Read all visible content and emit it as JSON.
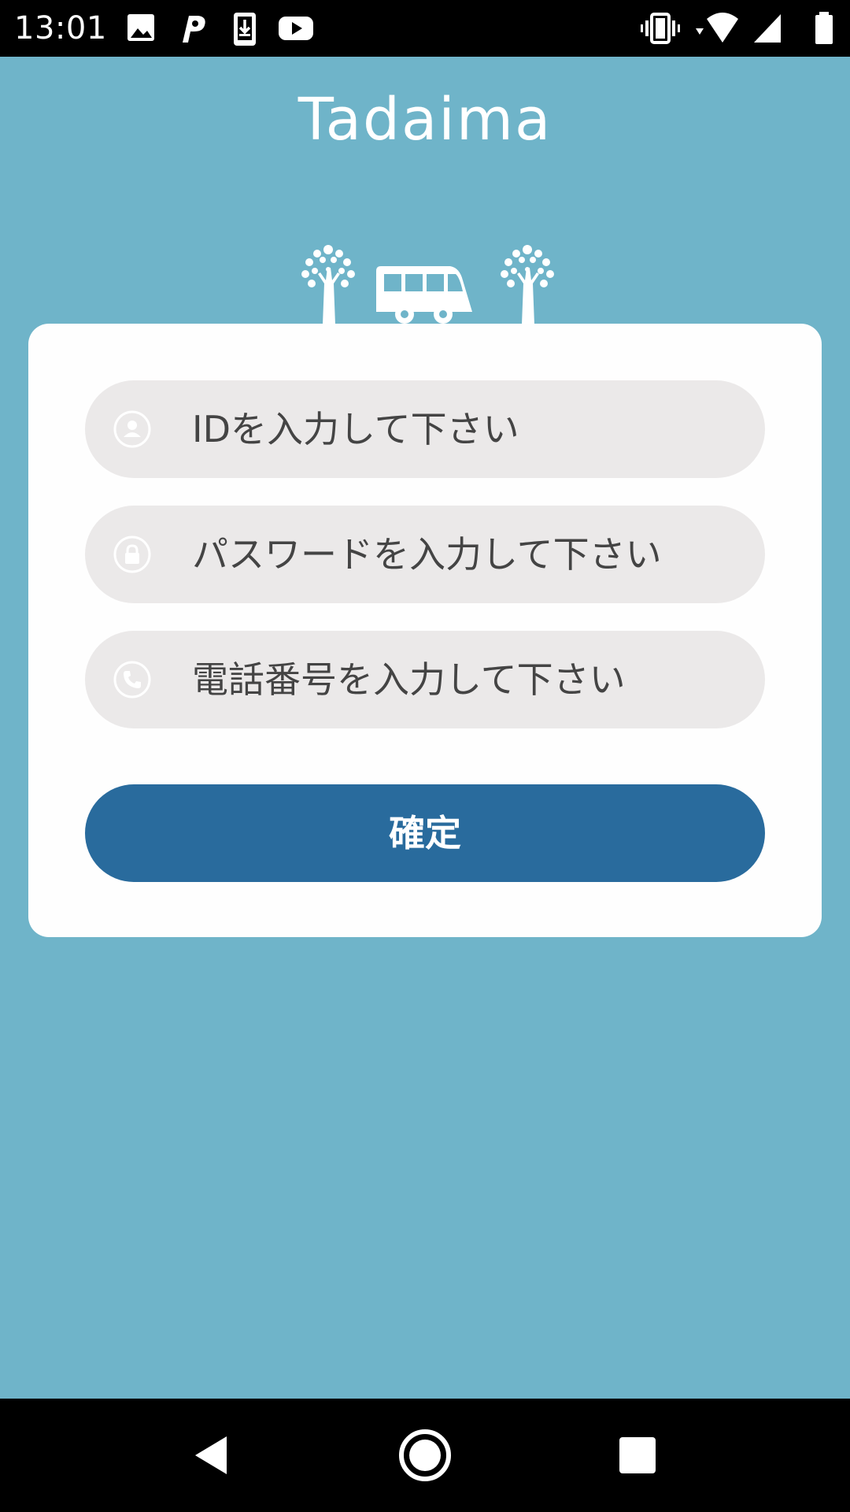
{
  "status_bar": {
    "time": "13:01",
    "left_icons": [
      "image-icon",
      "parking-app-icon",
      "download-icon",
      "youtube-icon"
    ],
    "right_icons": [
      "vibrate-icon",
      "wifi-icon",
      "cell-signal-icon",
      "battery-icon"
    ]
  },
  "app": {
    "logo": "Tadaima",
    "login_form": {
      "id_field": {
        "placeholder": "IDを入力して下さい",
        "icon": "person-icon"
      },
      "password_field": {
        "placeholder": "パスワードを入力して下さい",
        "icon": "lock-icon"
      },
      "phone_field": {
        "placeholder": "電話番号を入力して下さい",
        "icon": "phone-icon"
      },
      "submit_label": "確定"
    }
  },
  "colors": {
    "background": "#6fb4c9",
    "card": "#fefefe",
    "field": "#ebe9e9",
    "button": "#296b9d",
    "text": "#444444"
  },
  "nav_bar": {
    "buttons": [
      "back-icon",
      "home-icon",
      "recents-icon"
    ]
  }
}
